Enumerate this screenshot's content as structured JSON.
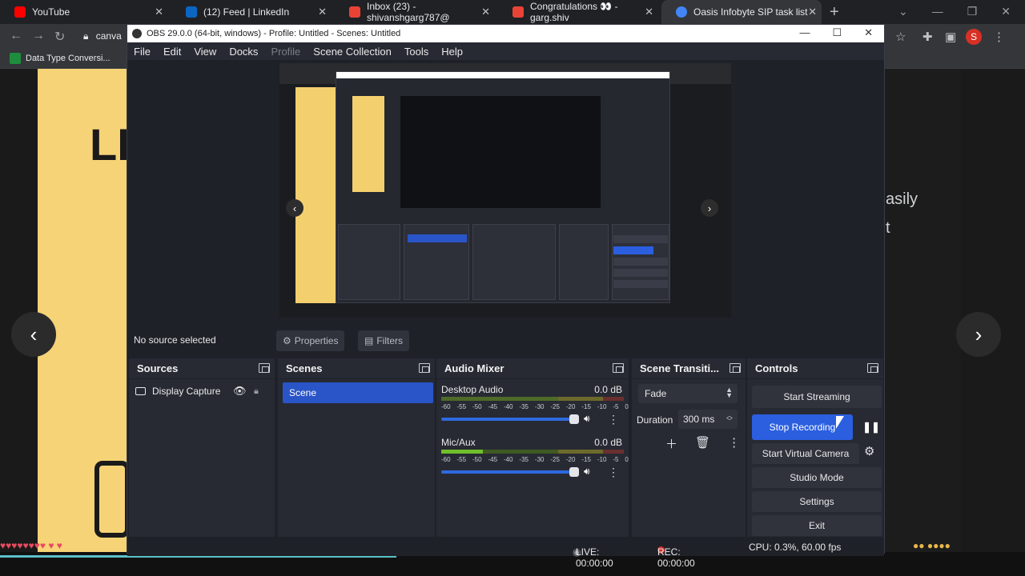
{
  "browser": {
    "tabs": [
      {
        "title": "YouTube",
        "color": "#ff0000"
      },
      {
        "title": "(12) Feed | LinkedIn",
        "color": "#0a66c2"
      },
      {
        "title": "Inbox (23) - shivanshgarg787@",
        "color": "#ea4335"
      },
      {
        "title": "Congratulations 👀 - garg.shiv",
        "color": "#ea4335"
      },
      {
        "title": "Oasis Infobyte SIP task list",
        "color": "#4285f4"
      }
    ],
    "address_text": "canva",
    "bookmark": "Data Type Conversi...",
    "profile_initial": "S"
  },
  "canva": {
    "slide_text": "LE",
    "side_text_1": "asily",
    "side_text_2": "t",
    "prev_arrow": "‹",
    "next_arrow": "›"
  },
  "obs": {
    "title": "OBS 29.0.0 (64-bit, windows) - Profile: Untitled - Scenes: Untitled",
    "menu": {
      "file": "File",
      "edit": "Edit",
      "view": "View",
      "docks": "Docks",
      "profile": "Profile",
      "scene_collection": "Scene Collection",
      "tools": "Tools",
      "help": "Help"
    },
    "source_bar": {
      "no_source": "No source selected",
      "properties": "Properties",
      "filters": "Filters"
    },
    "sources": {
      "title": "Sources",
      "item": "Display Capture"
    },
    "scenes": {
      "title": "Scenes",
      "item": "Scene"
    },
    "audio_mixer": {
      "title": "Audio Mixer",
      "channels": [
        {
          "name": "Desktop Audio",
          "db": "0.0 dB"
        },
        {
          "name": "Mic/Aux",
          "db": "0.0 dB"
        }
      ],
      "ticks": [
        "-60",
        "-55",
        "-50",
        "-45",
        "-40",
        "-35",
        "-30",
        "-25",
        "-20",
        "-15",
        "-10",
        "-5",
        "0"
      ]
    },
    "transitions": {
      "title": "Scene Transiti...",
      "selected": "Fade",
      "duration_label": "Duration",
      "duration_value": "300 ms"
    },
    "controls": {
      "title": "Controls",
      "start_streaming": "Start Streaming",
      "stop_recording": "Stop Recording",
      "start_virtual_camera": "Start Virtual Camera",
      "studio_mode": "Studio Mode",
      "settings": "Settings",
      "exit": "Exit"
    },
    "status": {
      "live": "LIVE: 00:00:00",
      "rec": "REC: 00:00:00",
      "cpu": "CPU: 0.3%, 60.00 fps"
    },
    "colors": {
      "accent": "#2b5fe0",
      "dock_bg": "#272a33",
      "window_bg": "#1f2128"
    }
  }
}
